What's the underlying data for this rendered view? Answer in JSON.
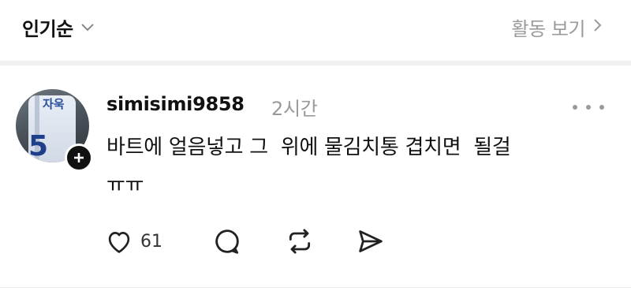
{
  "header": {
    "sort_label": "인기순",
    "activity_label": "활동 보기",
    "icons": {
      "sort": "chevron-down-icon",
      "activity": "chevron-right-icon"
    }
  },
  "post": {
    "avatar": {
      "jersey_text": "자욱",
      "jersey_number": "5"
    },
    "username": "simisimi9858",
    "timestamp": "2시간",
    "text": "바트에 얼음넣고 그  위에 물김치통 겹치면  될걸\nㅠㅠ",
    "actions": {
      "like_count": "61",
      "icons": [
        "heart-icon",
        "comment-icon",
        "repost-icon",
        "share-icon"
      ]
    }
  },
  "colors": {
    "text": "#111111",
    "muted": "#9a9a9a",
    "divider": "#f1f1f1"
  }
}
